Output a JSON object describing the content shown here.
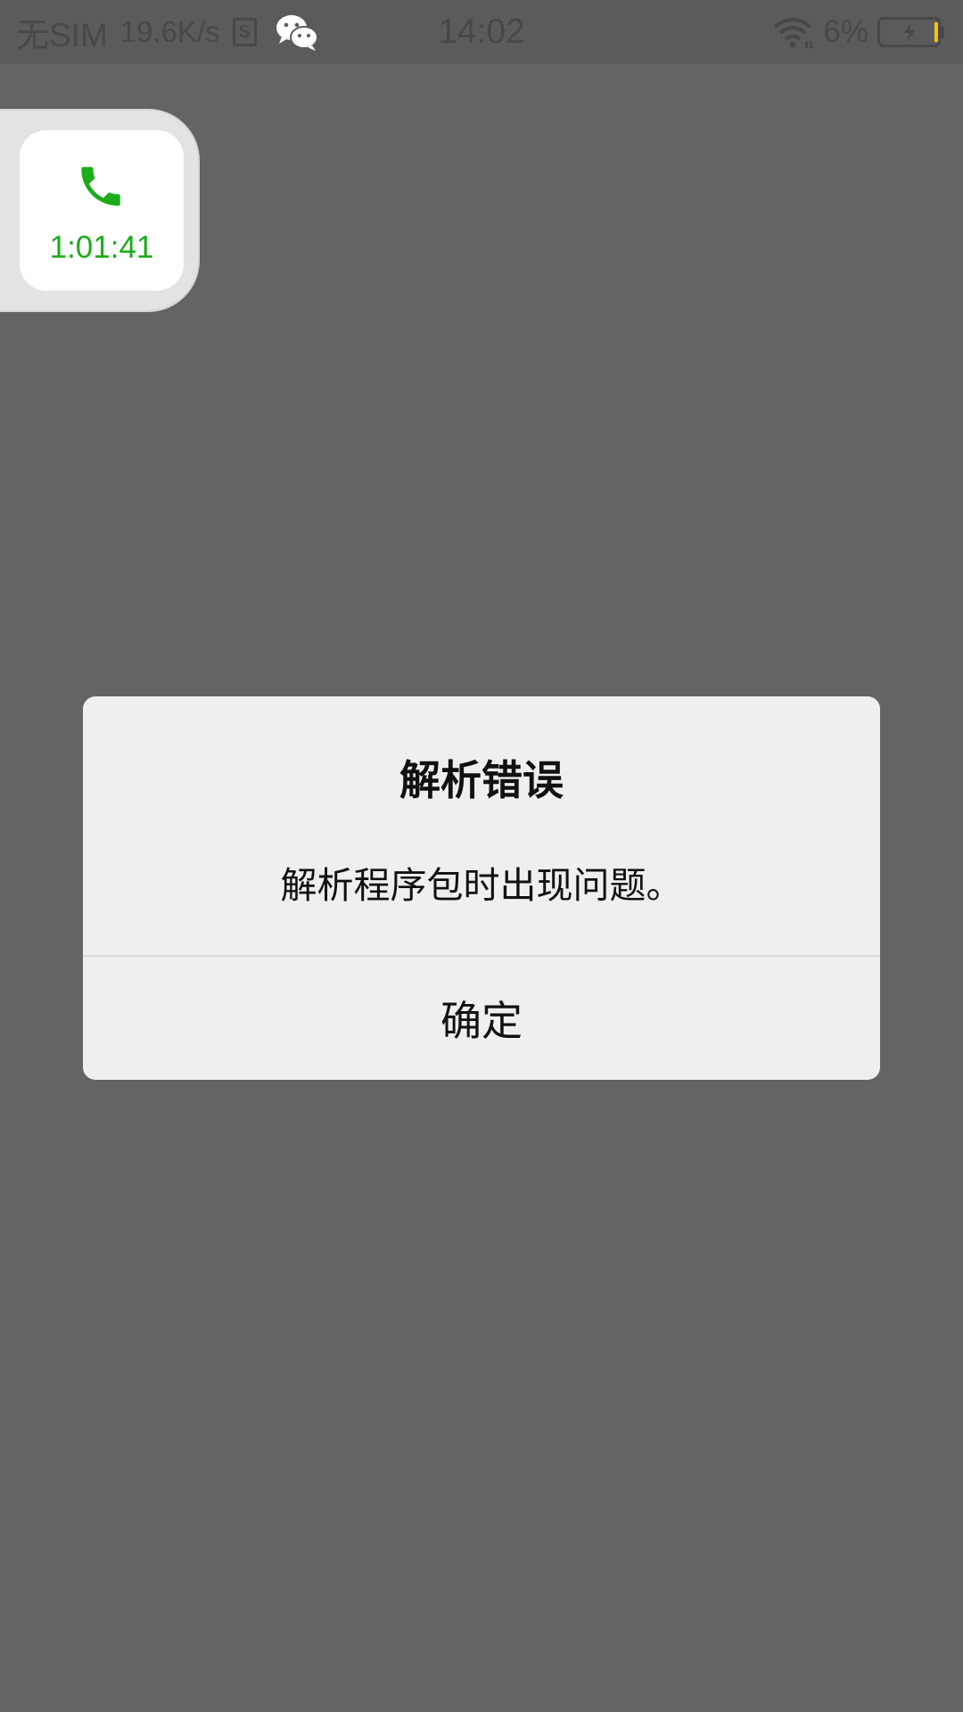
{
  "status_bar": {
    "carrier": "无SIM",
    "network_speed": "19.6K/s",
    "sd_icon": "sd-card-icon",
    "app_icon": "wechat-icon",
    "time": "14:02",
    "wifi_icon": "wifi-icon",
    "battery_percent": "6%",
    "battery_icon": "battery-charging-icon",
    "battery_level": 0.06,
    "battery_color": "#f5c400"
  },
  "call_widget": {
    "icon": "phone-icon",
    "duration": "1:01:41",
    "accent_color": "#1aad19"
  },
  "dialog": {
    "title": "解析错误",
    "message": "解析程序包时出现问题。",
    "ok_label": "确定"
  }
}
